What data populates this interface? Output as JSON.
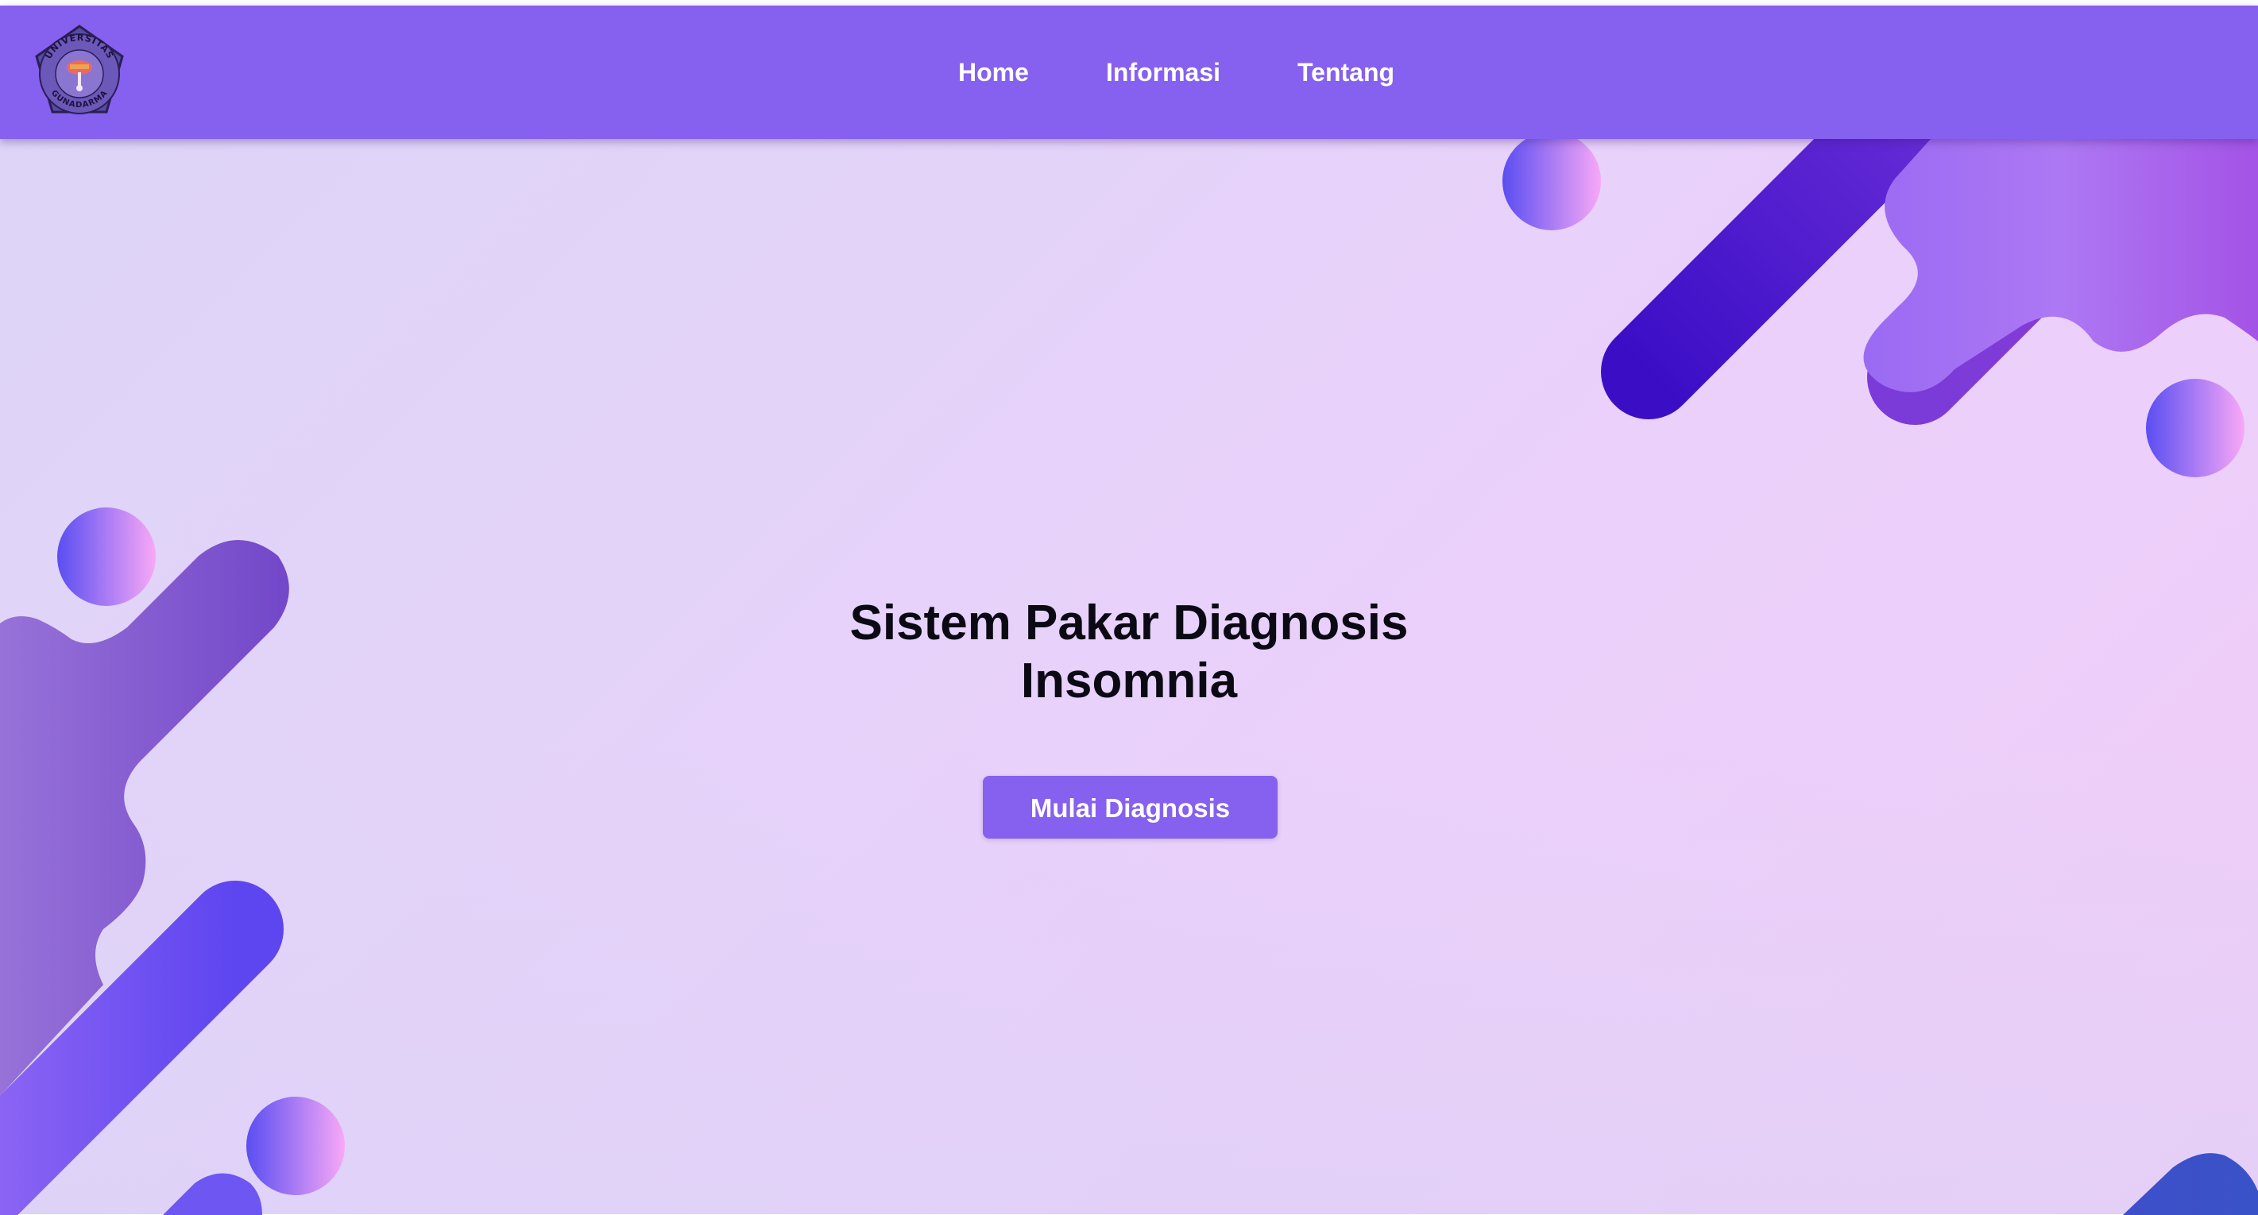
{
  "navbar": {
    "logo_icon": "universitas-gunadarma-seal-icon",
    "logo_text_top": "UNIVERSITAS",
    "logo_text_bottom": "GUNADARMA",
    "links": [
      {
        "label": "Home"
      },
      {
        "label": "Informasi"
      },
      {
        "label": "Tentang"
      }
    ]
  },
  "hero": {
    "title_line1": "Sistem Pakar Diagnosis",
    "title_line2": "Insomnia",
    "cta_label": "Mulai Diagnosis"
  },
  "colors": {
    "navbar_bg": "#8660ee",
    "button_bg": "#8660ee",
    "title_text": "#0b0a14",
    "hero_bg_start": "#dcd4f7",
    "hero_bg_end": "#f0cdf8"
  }
}
